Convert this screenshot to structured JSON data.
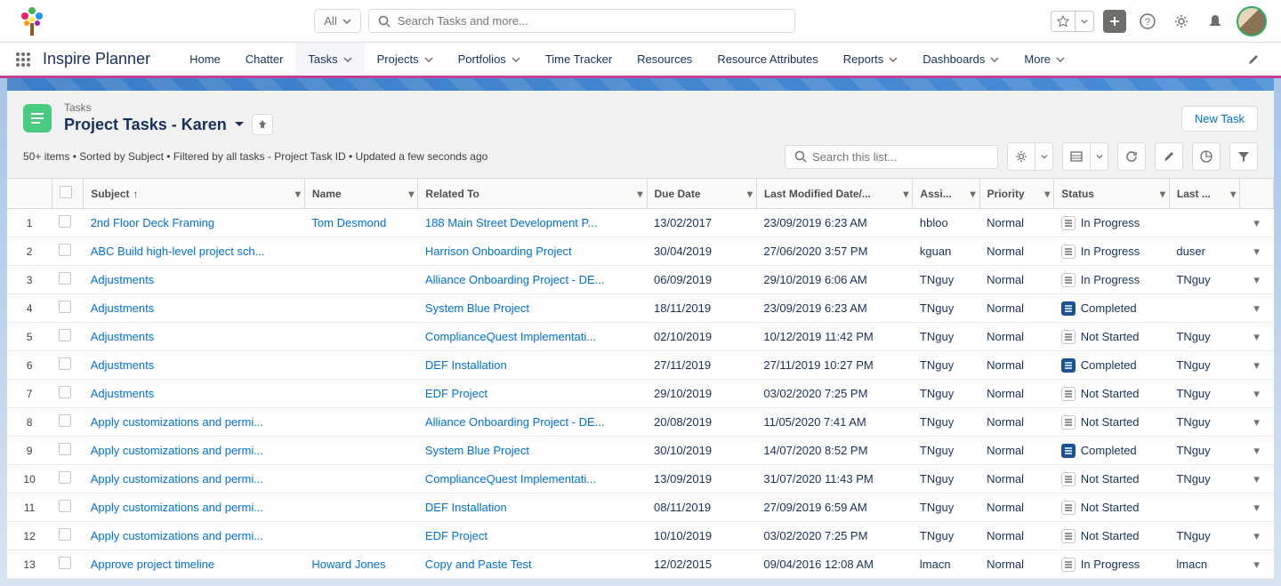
{
  "header": {
    "search_scope": "All",
    "search_placeholder": "Search Tasks and more..."
  },
  "nav": {
    "app_name": "Inspire Planner",
    "items": [
      {
        "label": "Home",
        "chevron": false
      },
      {
        "label": "Chatter",
        "chevron": false
      },
      {
        "label": "Tasks",
        "chevron": true,
        "active": true
      },
      {
        "label": "Projects",
        "chevron": true
      },
      {
        "label": "Portfolios",
        "chevron": true
      },
      {
        "label": "Time Tracker",
        "chevron": false
      },
      {
        "label": "Resources",
        "chevron": false
      },
      {
        "label": "Resource Attributes",
        "chevron": false
      },
      {
        "label": "Reports",
        "chevron": true
      },
      {
        "label": "Dashboards",
        "chevron": true
      },
      {
        "label": "More",
        "chevron": true
      }
    ]
  },
  "list": {
    "object_type": "Tasks",
    "view_name": "Project Tasks - Karen",
    "new_button": "New Task",
    "info": "50+ items • Sorted by Subject • Filtered by all tasks - Project Task ID • Updated a few seconds ago",
    "search_placeholder": "Search this list..."
  },
  "columns": {
    "subject": "Subject",
    "name": "Name",
    "related": "Related To",
    "due": "Due Date",
    "modified": "Last Modified Date/...",
    "assi": "Assi...",
    "priority": "Priority",
    "status": "Status",
    "last": "Last ..."
  },
  "rows": [
    {
      "n": "1",
      "subject": "2nd Floor Deck Framing",
      "name": "Tom Desmond",
      "related": "188 Main Street Development P...",
      "due": "13/02/2017",
      "modified": "23/09/2019 6:23 AM",
      "assi": "hbloo",
      "priority": "Normal",
      "status": "In Progress",
      "status_style": "gray",
      "last": ""
    },
    {
      "n": "2",
      "subject": "ABC Build high-level project sch...",
      "name": "",
      "related": "Harrison Onboarding Project",
      "due": "30/04/2019",
      "modified": "27/06/2020 3:57 PM",
      "assi": "kguan",
      "priority": "Normal",
      "status": "In Progress",
      "status_style": "gray",
      "last": "duser"
    },
    {
      "n": "3",
      "subject": "Adjustments",
      "name": "",
      "related": "Alliance Onboarding Project - DE...",
      "due": "06/09/2019",
      "modified": "29/10/2019 6:06 AM",
      "assi": "TNguy",
      "priority": "Normal",
      "status": "In Progress",
      "status_style": "gray",
      "last": "TNguy"
    },
    {
      "n": "4",
      "subject": "Adjustments",
      "name": "",
      "related": "System Blue Project",
      "due": "18/11/2019",
      "modified": "23/09/2019 6:23 AM",
      "assi": "TNguy",
      "priority": "Normal",
      "status": "Completed",
      "status_style": "blue",
      "last": ""
    },
    {
      "n": "5",
      "subject": "Adjustments",
      "name": "",
      "related": "ComplianceQuest Implementati...",
      "due": "02/10/2019",
      "modified": "10/12/2019 11:42 PM",
      "assi": "TNguy",
      "priority": "Normal",
      "status": "Not Started",
      "status_style": "gray",
      "last": "TNguy"
    },
    {
      "n": "6",
      "subject": "Adjustments",
      "name": "",
      "related": "DEF Installation",
      "due": "27/11/2019",
      "modified": "27/11/2019 10:27 PM",
      "assi": "TNguy",
      "priority": "Normal",
      "status": "Completed",
      "status_style": "blue",
      "last": "TNguy"
    },
    {
      "n": "7",
      "subject": "Adjustments",
      "name": "",
      "related": "EDF Project",
      "due": "29/10/2019",
      "modified": "03/02/2020 7:25 PM",
      "assi": "TNguy",
      "priority": "Normal",
      "status": "Not Started",
      "status_style": "gray",
      "last": "TNguy"
    },
    {
      "n": "8",
      "subject": "Apply customizations and permi...",
      "name": "",
      "related": "Alliance Onboarding Project - DE...",
      "due": "20/08/2019",
      "modified": "11/05/2020 7:41 AM",
      "assi": "TNguy",
      "priority": "Normal",
      "status": "Not Started",
      "status_style": "gray",
      "last": "TNguy"
    },
    {
      "n": "9",
      "subject": "Apply customizations and permi...",
      "name": "",
      "related": "System Blue Project",
      "due": "30/10/2019",
      "modified": "14/07/2020 8:52 PM",
      "assi": "TNguy",
      "priority": "Normal",
      "status": "Completed",
      "status_style": "blue",
      "last": "TNguy"
    },
    {
      "n": "10",
      "subject": "Apply customizations and permi...",
      "name": "",
      "related": "ComplianceQuest Implementati...",
      "due": "13/09/2019",
      "modified": "31/07/2020 11:43 PM",
      "assi": "TNguy",
      "priority": "Normal",
      "status": "Not Started",
      "status_style": "gray",
      "last": "TNguy"
    },
    {
      "n": "11",
      "subject": "Apply customizations and permi...",
      "name": "",
      "related": "DEF Installation",
      "due": "08/11/2019",
      "modified": "27/09/2019 6:59 AM",
      "assi": "TNguy",
      "priority": "Normal",
      "status": "Not Started",
      "status_style": "gray",
      "last": ""
    },
    {
      "n": "12",
      "subject": "Apply customizations and permi...",
      "name": "",
      "related": "EDF Project",
      "due": "10/10/2019",
      "modified": "03/02/2020 7:25 PM",
      "assi": "TNguy",
      "priority": "Normal",
      "status": "Not Started",
      "status_style": "gray",
      "last": "TNguy"
    },
    {
      "n": "13",
      "subject": "Approve project timeline",
      "name": "Howard Jones",
      "related": "Copy and Paste Test",
      "due": "12/02/2015",
      "modified": "09/04/2016 12:08 AM",
      "assi": "lmacn",
      "priority": "Normal",
      "status": "In Progress",
      "status_style": "gray",
      "last": "lmacn"
    }
  ]
}
